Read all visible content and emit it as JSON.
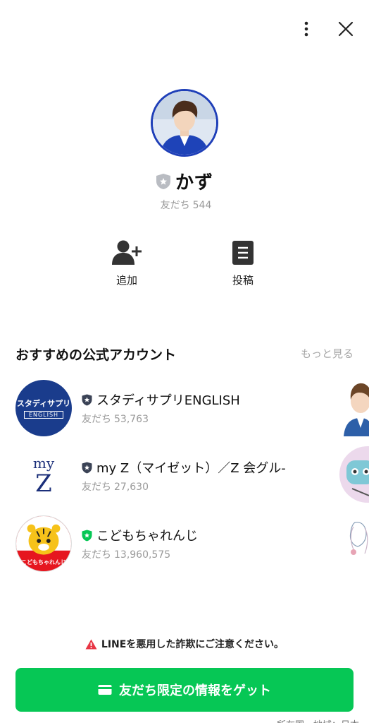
{
  "profile": {
    "name": "かず",
    "friends_label": "友だち",
    "friends_count": "544"
  },
  "actions": [
    {
      "label": "追加",
      "icon": "add-friend-icon"
    },
    {
      "label": "投稿",
      "icon": "post-icon"
    }
  ],
  "recommended": {
    "title": "おすすめの公式アカウント",
    "more_label": "もっと見る",
    "items": [
      {
        "name": "スタディサプリENGLISH",
        "friends_label": "友だち",
        "friends_count": "53,763",
        "logo_text": "スタディサプリ",
        "logo_sub": "ENGLISH",
        "badge_color": "#3b4356"
      },
      {
        "name": "my Z（マイゼット）／Z 会グル-",
        "friends_label": "友だち",
        "friends_count": "27,630",
        "logo_text_top": "my",
        "logo_text_bottom": "Z",
        "badge_color": "#3b4356"
      },
      {
        "name": "こどもちゃれんじ",
        "friends_label": "友だち",
        "friends_count": "13,960,575",
        "logo_text": "こどもちゃれんじ",
        "badge_color": "#06c755"
      }
    ]
  },
  "warning": {
    "text": "LINEを悪用した詐欺にご注意ください。",
    "icon": "warning-icon"
  },
  "cta": {
    "label": "友だち限定の情報をゲット",
    "icon": "wallet-icon",
    "color": "#06c755"
  },
  "footer": {
    "text": "所在国・地域：日本"
  },
  "colors": {
    "avatar_border": "#1f3fb8",
    "muted": "#9a9a9a"
  }
}
